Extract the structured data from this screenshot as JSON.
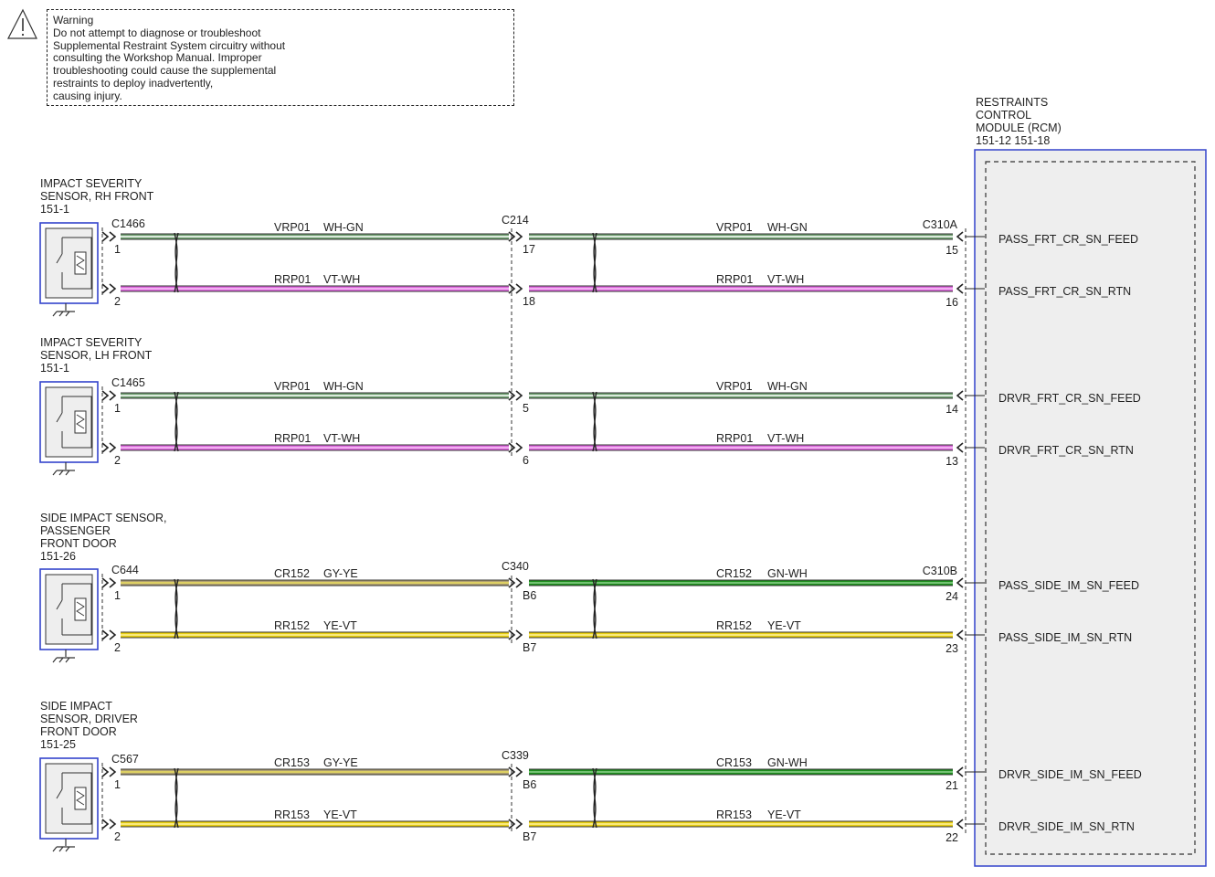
{
  "warning": {
    "icon": "warning-triangle-icon",
    "lines": [
      "Warning",
      "Do not attempt to diagnose or troubleshoot",
      "Supplemental Restraint System circuitry without",
      "consulting the Workshop Manual. Improper",
      "troubleshooting could cause the supplemental",
      "restraints to deploy inadvertently,",
      "causing injury."
    ]
  },
  "module": {
    "title_lines": [
      "RESTRAINTS",
      "CONTROL",
      "MODULE (RCM)"
    ],
    "refs": "151-12    151-18",
    "fill_color": "#eeeeee",
    "border_color": "#3344cc"
  },
  "wire_colors": {
    "WH-GN": {
      "base": "#6fa070",
      "stripe": "#ffffff"
    },
    "VT-WH": {
      "base": "#dd66dd",
      "stripe": "#f6c8f6"
    },
    "GY-YE": {
      "base": "#b0a070",
      "stripe": "#ece060"
    },
    "GN-WH": {
      "base": "#1f8f1f",
      "stripe": "#8fd48f"
    },
    "YE-VT": {
      "base": "#e8cf10",
      "stripe": "#fff3a0"
    }
  },
  "sensors": [
    {
      "name_lines": [
        "IMPACT SEVERITY",
        "SENSOR, RH FRONT"
      ],
      "ref": "151-1",
      "connector": "C1466",
      "pins": [
        "1",
        "2"
      ],
      "inline_connector": "C214",
      "inline_pins": [
        "17",
        "18"
      ],
      "module_connector": "C310A",
      "module_pins": [
        "15",
        "16"
      ],
      "wires_left": [
        {
          "circuit": "VRP01",
          "color": "WH-GN"
        },
        {
          "circuit": "RRP01",
          "color": "VT-WH"
        }
      ],
      "wires_right": [
        {
          "circuit": "VRP01",
          "color": "WH-GN"
        },
        {
          "circuit": "RRP01",
          "color": "VT-WH"
        }
      ],
      "signals": [
        "PASS_FRT_CR_SN_FEED",
        "PASS_FRT_CR_SN_RTN"
      ]
    },
    {
      "name_lines": [
        "IMPACT SEVERITY",
        "SENSOR, LH FRONT"
      ],
      "ref": "151-1",
      "connector": "C1465",
      "pins": [
        "1",
        "2"
      ],
      "inline_connector": "",
      "inline_pins": [
        "5",
        "6"
      ],
      "module_connector": "",
      "module_pins": [
        "14",
        "13"
      ],
      "wires_left": [
        {
          "circuit": "VRP01",
          "color": "WH-GN"
        },
        {
          "circuit": "RRP01",
          "color": "VT-WH"
        }
      ],
      "wires_right": [
        {
          "circuit": "VRP01",
          "color": "WH-GN"
        },
        {
          "circuit": "RRP01",
          "color": "VT-WH"
        }
      ],
      "signals": [
        "DRVR_FRT_CR_SN_FEED",
        "DRVR_FRT_CR_SN_RTN"
      ]
    },
    {
      "name_lines": [
        "SIDE IMPACT SENSOR,",
        "PASSENGER",
        "FRONT DOOR"
      ],
      "ref": "151-26",
      "connector": "C644",
      "pins": [
        "1",
        "2"
      ],
      "inline_connector": "C340",
      "inline_pins": [
        "B6",
        "B7"
      ],
      "module_connector": "C310B",
      "module_pins": [
        "24",
        "23"
      ],
      "wires_left": [
        {
          "circuit": "CR152",
          "color": "GY-YE"
        },
        {
          "circuit": "RR152",
          "color": "YE-VT"
        }
      ],
      "wires_right": [
        {
          "circuit": "CR152",
          "color": "GN-WH"
        },
        {
          "circuit": "RR152",
          "color": "YE-VT"
        }
      ],
      "signals": [
        "PASS_SIDE_IM_SN_FEED",
        "PASS_SIDE_IM_SN_RTN"
      ]
    },
    {
      "name_lines": [
        "SIDE IMPACT",
        "SENSOR, DRIVER",
        "FRONT DOOR"
      ],
      "ref": "151-25",
      "connector": "C567",
      "pins": [
        "1",
        "2"
      ],
      "inline_connector": "C339",
      "inline_pins": [
        "B6",
        "B7"
      ],
      "module_connector": "",
      "module_pins": [
        "21",
        "22"
      ],
      "wires_left": [
        {
          "circuit": "CR153",
          "color": "GY-YE"
        },
        {
          "circuit": "RR153",
          "color": "YE-VT"
        }
      ],
      "wires_right": [
        {
          "circuit": "CR153",
          "color": "GN-WH"
        },
        {
          "circuit": "RR153",
          "color": "YE-VT"
        }
      ],
      "signals": [
        "DRVR_SIDE_IM_SN_FEED",
        "DRVR_SIDE_IM_SN_RTN"
      ]
    }
  ]
}
